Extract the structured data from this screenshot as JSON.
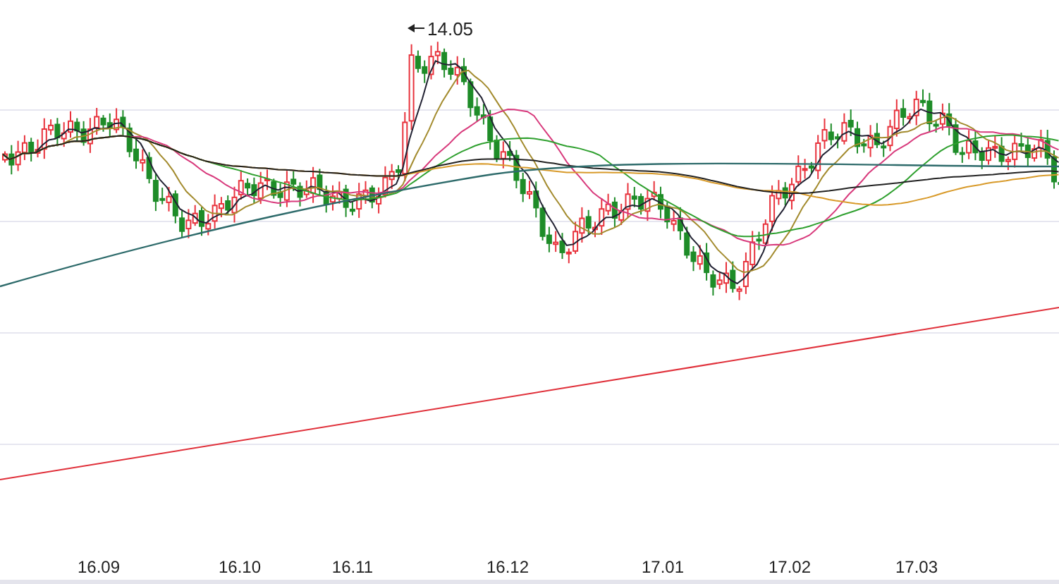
{
  "chart": {
    "price_marker": "14.05",
    "x_axis_labels": [
      "16.09",
      "16.10",
      "16.11",
      "16.12",
      "17.01",
      "17.02",
      "17.03"
    ]
  }
}
